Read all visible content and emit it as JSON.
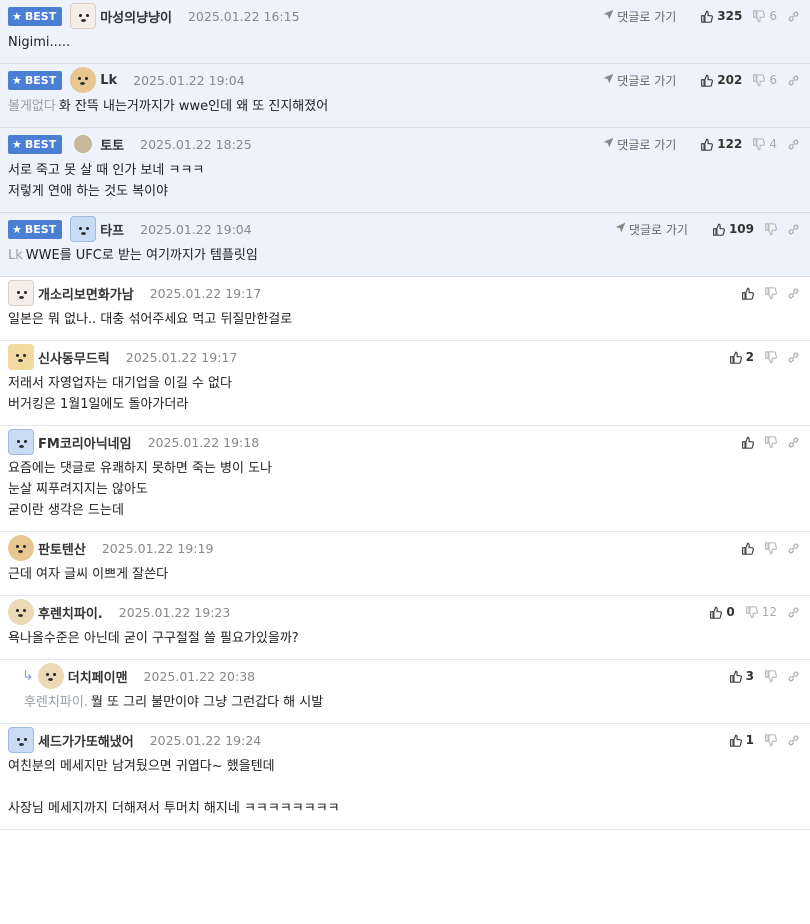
{
  "labels": {
    "best": "BEST",
    "goto": "댓글로 가기"
  },
  "comments": [
    {
      "best": true,
      "name": "마성의냥냥이",
      "date": "2025.01.22 16:15",
      "up": "325",
      "down": "6",
      "ref": "",
      "lines": [
        "Nigimi....."
      ],
      "avatar": "dog-white"
    },
    {
      "best": true,
      "name": "Lk",
      "date": "2025.01.22 19:04",
      "up": "202",
      "down": "6",
      "ref": "볼게없다",
      "lines": [
        "화 잔뜩 내는거까지가 wwe인데 왜 또 진지해졌어"
      ],
      "avatar": "puppy"
    },
    {
      "best": true,
      "name": "토토",
      "date": "2025.01.22 18:25",
      "up": "122",
      "down": "4",
      "ref": "",
      "lines": [
        "서로 죽고 못 살 때 인가 보네 ㅋㅋㅋ",
        "저렇게 연애 하는 것도 복이야"
      ],
      "avatar": "ball"
    },
    {
      "best": true,
      "name": "타프",
      "date": "2025.01.22 19:04",
      "up": "109",
      "down": "",
      "ref": "Lk",
      "lines": [
        "WWE를 UFC로 받는 여기까지가 템플릿임"
      ],
      "avatar": "ghost"
    },
    {
      "best": false,
      "name": "개소리보면화가남",
      "date": "2025.01.22 19:17",
      "up": "",
      "down": "",
      "ref": "",
      "lines": [
        "일본은 뭐 없나.. 대충 섞어주세요 먹고 뒤질만한걸로"
      ],
      "avatar": "dog-white"
    },
    {
      "best": false,
      "name": "신사동무드릭",
      "date": "2025.01.22 19:17",
      "up": "2",
      "down": "",
      "ref": "",
      "lines": [
        "저래서 자영업자는 대기업을 이길 수 없다",
        "버거킹은 1월1일에도 돌아가더라"
      ],
      "avatar": "fox"
    },
    {
      "best": false,
      "name": "FM코리아닉네임",
      "date": "2025.01.22 19:18",
      "up": "",
      "down": "",
      "ref": "",
      "lines": [
        "요즘에는 댓글로 유쾌하지 못하면 죽는 병이 도나",
        "눈살 찌푸려지지는 않아도",
        "굳이란 생각은 드는데"
      ],
      "avatar": "ghost"
    },
    {
      "best": false,
      "name": "판토텐산",
      "date": "2025.01.22 19:19",
      "up": "",
      "down": "",
      "ref": "",
      "lines": [
        "근데 여자 글씨 이쁘게 잘쓴다"
      ],
      "avatar": "puppy"
    },
    {
      "best": false,
      "name": "후렌치파이.",
      "date": "2025.01.22 19:23",
      "up": "0",
      "down": "12",
      "ref": "",
      "lines": [
        "욕나올수준은 아닌데 굳이 구구절절 쓸 필요가있을까?"
      ],
      "avatar": "puppy-light"
    },
    {
      "best": false,
      "reply": true,
      "name": "더치페이맨",
      "date": "2025.01.22 20:38",
      "up": "3",
      "down": "",
      "ref": "후렌치파이.",
      "lines": [
        "뭘 또 그리 불만이야 그냥 그런갑다 해 시발"
      ],
      "avatar": "puppy-light"
    },
    {
      "best": false,
      "name": "세드가가또해냈어",
      "date": "2025.01.22 19:24",
      "up": "1",
      "down": "",
      "ref": "",
      "lines": [
        "여친분의 메세지만 남겨뒀으면 귀엽다~ 했을텐데",
        "",
        "사장님 메세지까지 더해져서 투머치 해지네 ㅋㅋㅋㅋㅋㅋㅋㅋ"
      ],
      "avatar": "ghost"
    }
  ],
  "colors": {
    "badge": "#4a7fd4",
    "best_bg": "#eef2fa"
  },
  "icons": {
    "up": "thumbs-up-icon",
    "down": "thumbs-down-icon",
    "link": "link-icon",
    "goto": "send-arrow-icon",
    "reply": "reply-arrow-icon"
  }
}
